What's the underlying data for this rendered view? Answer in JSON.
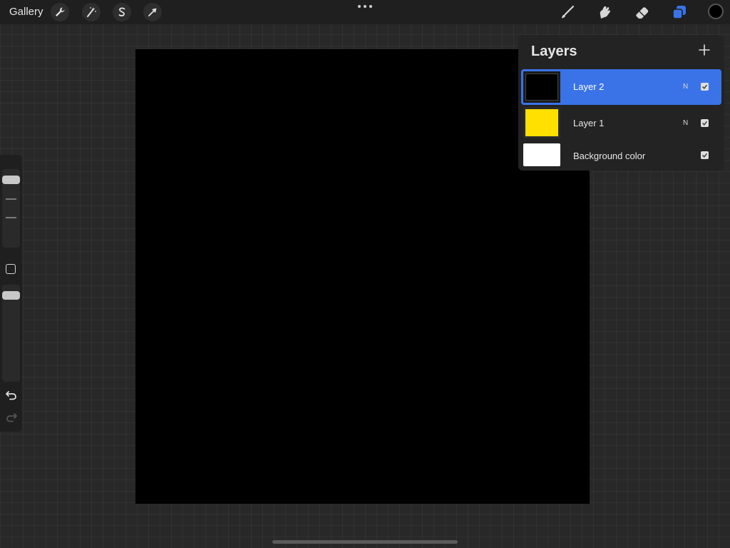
{
  "topbar": {
    "gallery_label": "Gallery",
    "left_tools": [
      "wrench-icon",
      "magic-wand-icon",
      "selection-icon",
      "transform-arrow-icon"
    ],
    "right_tools": [
      "brush-icon",
      "smudge-icon",
      "eraser-icon",
      "layers-icon"
    ],
    "current_color": "#000000",
    "accent_color": "#3a73e8"
  },
  "canvas": {
    "background": "#000000"
  },
  "sidebar": {
    "icons": [
      "size-slider",
      "modify-square-icon",
      "opacity-slider",
      "undo-icon",
      "redo-icon"
    ]
  },
  "layers_panel": {
    "title": "Layers",
    "add_icon": "plus-icon",
    "layers": [
      {
        "name": "Layer 2",
        "blend_mode": "N",
        "visible": true,
        "selected": true,
        "thumb_color": "#000000"
      },
      {
        "name": "Layer 1",
        "blend_mode": "N",
        "visible": true,
        "selected": false,
        "thumb_color": "#ffe000"
      },
      {
        "name": "Background color",
        "visible": true,
        "selected": false,
        "thumb_color": "#ffffff"
      }
    ]
  }
}
